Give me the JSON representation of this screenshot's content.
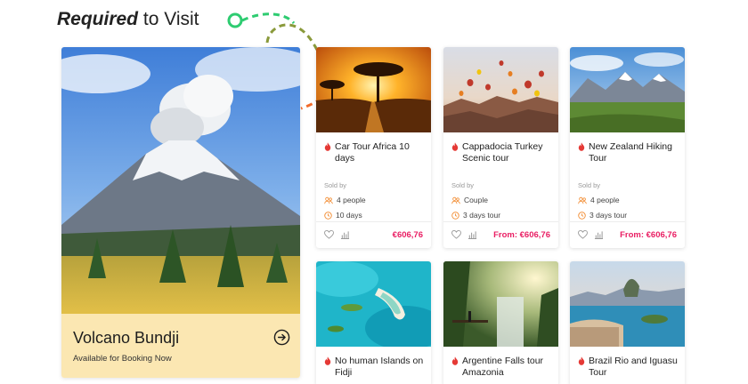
{
  "heading": {
    "strong": "Required",
    "light": "to Visit"
  },
  "feature": {
    "title": "Volcano Bundji",
    "subtitle": "Available for Booking Now",
    "panel_color": "#fbe7b2"
  },
  "labels": {
    "sold_by": "Sold by"
  },
  "colors": {
    "accent": "#e91e63",
    "flame": "#e53935",
    "deco_green": "#2ecc71",
    "deco_olive": "#8a9a3b",
    "deco_orange": "#f26b2a"
  },
  "cards": [
    {
      "name": "Car Tour Africa 10 days",
      "people": "4 people",
      "duration": "10 days",
      "price": "€606,76"
    },
    {
      "name": "Cappadocia Turkey Scenic tour",
      "people": "Couple",
      "duration": "3 days tour",
      "price": "From: €606,76"
    },
    {
      "name": "New Zealand Hiking Tour",
      "people": "4 people",
      "duration": "3 days tour",
      "price": "From: €606,76"
    },
    {
      "name": "No human Islands on Fidji"
    },
    {
      "name": "Argentine Falls tour Amazonia"
    },
    {
      "name": "Brazil Rio and Iguasu Tour"
    }
  ]
}
